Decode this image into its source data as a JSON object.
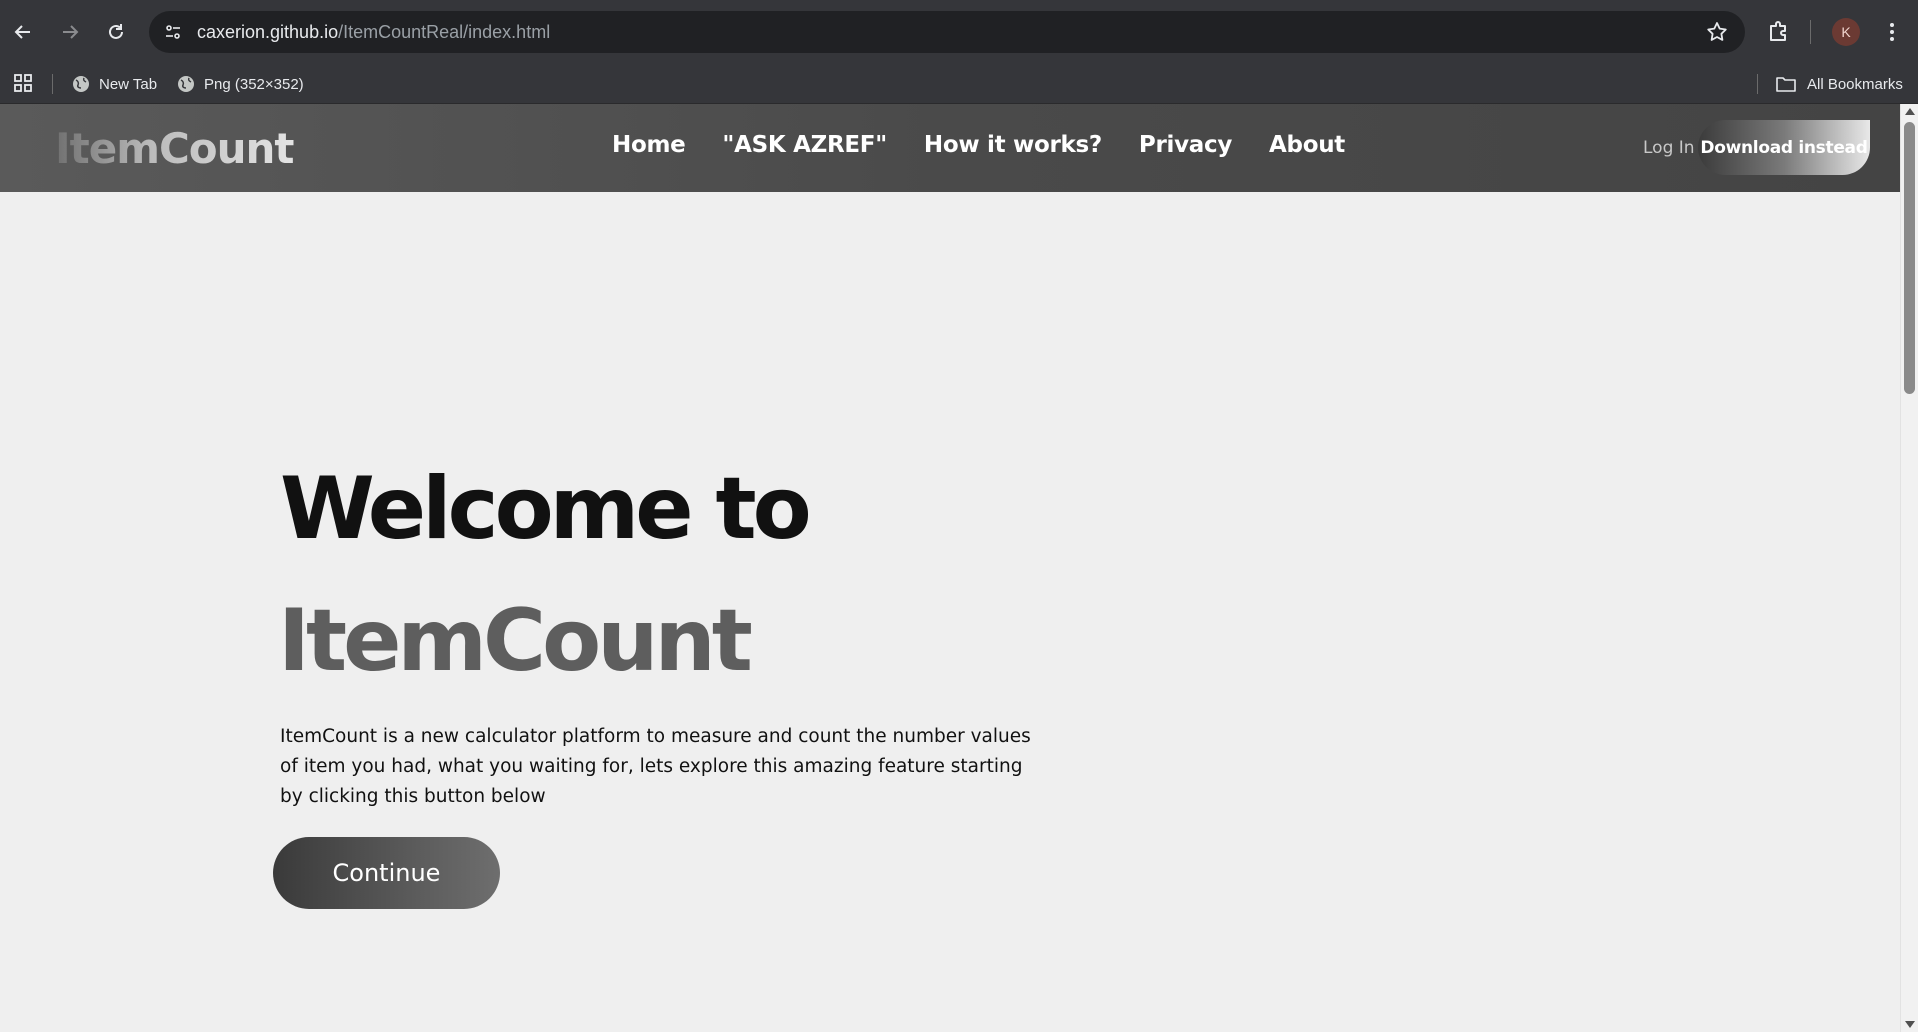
{
  "browser": {
    "url_host": "caxerion.github.io",
    "url_path": "/ItemCountReal/index.html",
    "profile_initial": "K",
    "bookmarks": [
      {
        "label": "New Tab",
        "icon": "globe-icon"
      },
      {
        "label": "Png (352×352)",
        "icon": "globe-icon"
      }
    ],
    "all_bookmarks_label": "All Bookmarks"
  },
  "site": {
    "logo": "ItemCount",
    "nav": [
      "Home",
      "\"ASK AZREF\"",
      "How it works?",
      "Privacy",
      "About"
    ],
    "login_label": "Log In",
    "download_label": "Download instead"
  },
  "hero": {
    "title_line1": "Welcome to",
    "title_line2": "ItemCount",
    "description": "ItemCount is a new calculator platform to measure and count the number values of item you had, what you waiting for, lets explore this amazing feature starting by clicking this button below",
    "continue_label": "Continue"
  },
  "colors": {
    "browser_chrome": "#35363a",
    "address_bar": "#202124",
    "page_bg": "#efefef",
    "header_bg": "#4a4a4a",
    "hero_accent": "#5e5e5e"
  }
}
